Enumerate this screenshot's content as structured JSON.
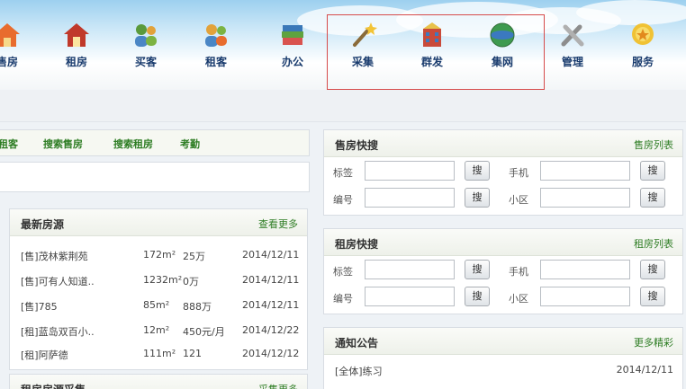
{
  "topnav": {
    "items": [
      {
        "label": "售房",
        "icon": "house-sale-icon"
      },
      {
        "label": "租房",
        "icon": "house-rent-icon"
      },
      {
        "label": "买客",
        "icon": "buyers-icon"
      },
      {
        "label": "租客",
        "icon": "tenants-icon"
      },
      {
        "label": "办公",
        "icon": "office-books-icon"
      },
      {
        "label": "采集",
        "icon": "magic-wand-icon"
      },
      {
        "label": "群发",
        "icon": "building-broadcast-icon"
      },
      {
        "label": "集网",
        "icon": "globe-icon"
      },
      {
        "label": "管理",
        "icon": "tools-icon"
      },
      {
        "label": "服务",
        "icon": "service-badge-icon"
      }
    ]
  },
  "links": {
    "items": [
      "租客",
      "搜索售房",
      "搜索租房",
      "考勤"
    ]
  },
  "latest": {
    "title": "最新房源",
    "more": "查看更多",
    "rows": [
      {
        "name": "[售]茂林紫荆苑",
        "area": "172m²",
        "price": "25万",
        "date": "2014/12/11"
      },
      {
        "name": "[售]可有人知道..",
        "area": "1232m²",
        "price": "0万",
        "date": "2014/12/11"
      },
      {
        "name": "[售]785",
        "area": "85m²",
        "price": "888万",
        "date": "2014/12/11"
      },
      {
        "name": "[租]蓝岛双百小..",
        "area": "12m²",
        "price": "450元/月",
        "date": "2014/12/22"
      },
      {
        "name": "[租]阿萨德",
        "area": "111m²",
        "price": "121",
        "date": "2014/12/12"
      }
    ]
  },
  "collect": {
    "title": "租房房源采集",
    "more": "采集更多"
  },
  "sale_search": {
    "title": "售房快搜",
    "more": "售房列表",
    "label_tag": "标签",
    "label_phone": "手机",
    "label_code": "编号",
    "label_community": "小区",
    "btn": "搜"
  },
  "rent_search": {
    "title": "租房快搜",
    "more": "租房列表",
    "label_tag": "标签",
    "label_phone": "手机",
    "label_code": "编号",
    "label_community": "小区",
    "btn": "搜"
  },
  "notice": {
    "title": "通知公告",
    "more": "更多精彩",
    "items": [
      {
        "text": "[全体]练习",
        "date": "2014/12/11"
      }
    ]
  },
  "colors": {
    "accent_green": "#2e7d24",
    "nav_text": "#1a3c6e",
    "highlight_border": "#d64b4b"
  }
}
